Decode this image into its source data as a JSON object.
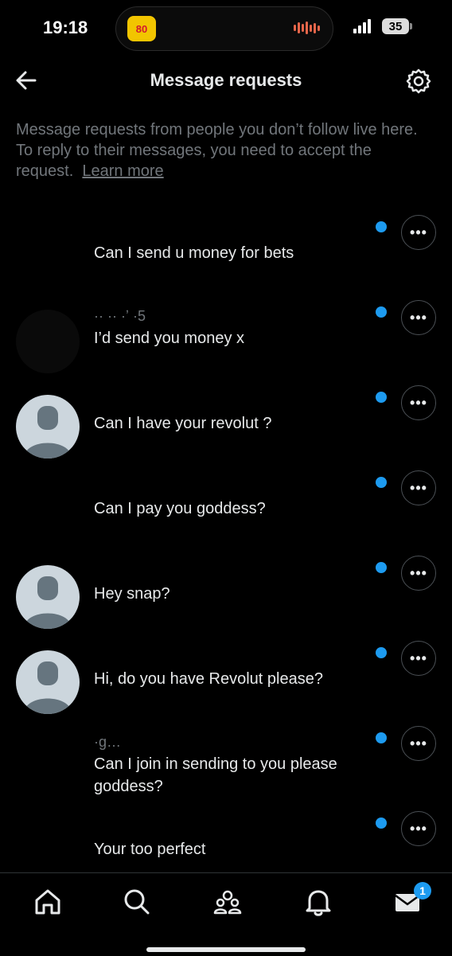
{
  "status_bar": {
    "time": "19:18",
    "battery": "35",
    "island_app_label": "80",
    "icons": [
      "signal-icon",
      "battery-icon",
      "audio-waveform-icon"
    ]
  },
  "header": {
    "title": "Message requests",
    "back_icon": "arrow-left-icon",
    "settings_icon": "gear-icon"
  },
  "info": {
    "text": "Message requests from people you don’t follow live here. To reply to their messages, you need to accept the request.",
    "link": "Learn more"
  },
  "conversations": [
    {
      "name": "",
      "message": "Can I send u money for bets",
      "avatar": "hidden",
      "unread": true
    },
    {
      "name": "·· ·· ·ʼ ·5",
      "message": "I’d send you money x",
      "avatar": "dark",
      "unread": true
    },
    {
      "name": "",
      "message": "Can I have your revolut ?",
      "avatar": "default",
      "unread": true
    },
    {
      "name": "",
      "message": "Can I pay you goddess?",
      "avatar": "hidden",
      "unread": true
    },
    {
      "name": "",
      "message": "Hey snap?",
      "avatar": "default",
      "unread": true
    },
    {
      "name": "",
      "message": "Hi, do you have Revolut please?",
      "avatar": "default",
      "unread": true
    },
    {
      "name": "·g…",
      "message": "Can I join in sending to you please goddess?",
      "avatar": "hidden",
      "unread": true
    },
    {
      "name": "",
      "message": "Your too perfect",
      "avatar": "hidden",
      "unread": true
    }
  ],
  "more_label": "•••",
  "tab_bar": {
    "tabs": [
      "home-icon",
      "search-icon",
      "communities-icon",
      "bell-icon",
      "envelope-icon"
    ],
    "messages_badge": "1"
  },
  "colors": {
    "accent": "#1d9bf0",
    "background": "#000000",
    "muted": "#71767b",
    "text": "#e7e9ea"
  }
}
